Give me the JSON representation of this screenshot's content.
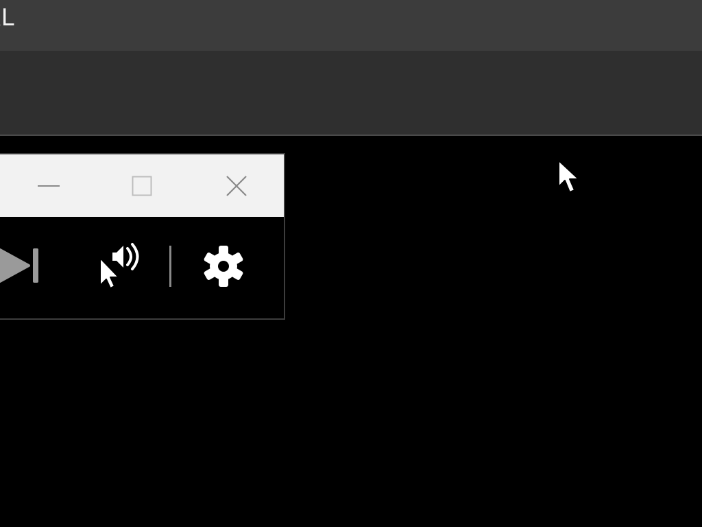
{
  "window": {
    "title": "RL"
  },
  "colors": {
    "title_bar": "#3c3c3c",
    "toolbar_band": "#2f2f2f",
    "content_bg": "#000000",
    "mini_titlebar": "#f2f2f2",
    "icon_white": "#ffffff",
    "icon_gray": "#9a9a9a"
  },
  "mini_player": {
    "caption_buttons": [
      {
        "name": "minimize",
        "icon": "minimize-icon"
      },
      {
        "name": "maximize",
        "icon": "maximize-icon"
      },
      {
        "name": "close",
        "icon": "close-icon"
      }
    ],
    "controls": [
      {
        "name": "next-track",
        "icon": "skip-next-icon"
      },
      {
        "name": "voice",
        "icon": "cursor-speaker-icon"
      },
      {
        "name": "settings",
        "icon": "gear-icon"
      }
    ]
  },
  "cursor": {
    "icon": "mouse-pointer-icon"
  }
}
